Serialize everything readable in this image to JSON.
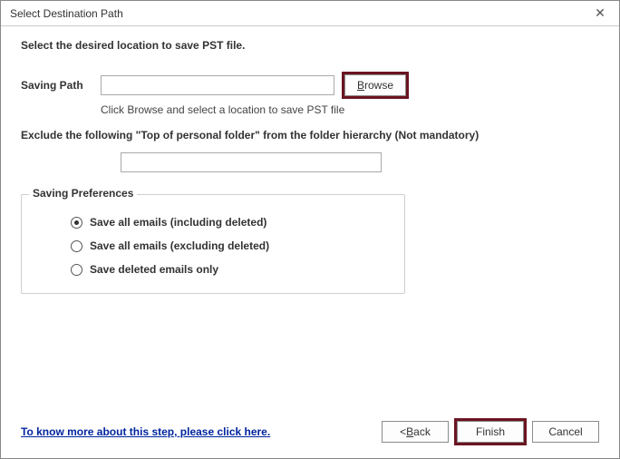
{
  "window": {
    "title": "Select Destination Path",
    "close_glyph": "✕"
  },
  "header": {
    "instruction": "Select the desired location to save PST file."
  },
  "saving": {
    "label": "Saving Path",
    "value": "",
    "browse_label": "Browse",
    "hint": "Click Browse and select a location to save PST file"
  },
  "exclude": {
    "label": "Exclude the following \"Top of personal folder\" from the folder hierarchy  (Not mandatory)",
    "value": ""
  },
  "prefs": {
    "legend": "Saving Preferences",
    "selected": 0,
    "options": [
      {
        "label": "Save all emails (including deleted)"
      },
      {
        "label": "Save all emails (excluding deleted)"
      },
      {
        "label": "Save deleted emails only"
      }
    ]
  },
  "footer": {
    "help_text": "To know more about this step, please click here.",
    "back_label": "< Back",
    "finish_label": "Finish",
    "cancel_label": "Cancel"
  }
}
